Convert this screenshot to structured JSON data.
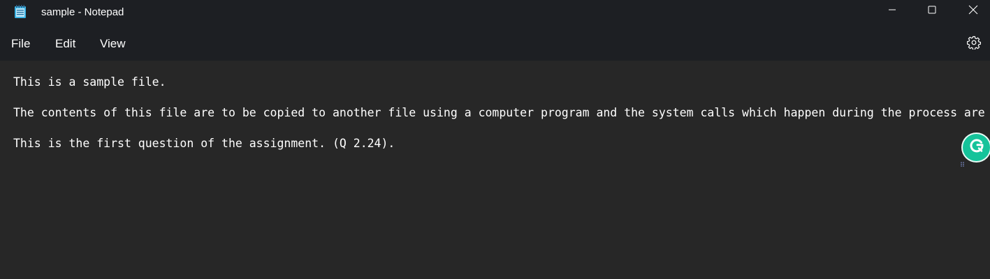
{
  "window": {
    "title": "sample - Notepad"
  },
  "titlebar": {
    "icons": {
      "app": "notepad-icon",
      "minimize": "minimize-icon",
      "maximize": "maximize-icon",
      "close": "close-icon"
    }
  },
  "menu": {
    "file": "File",
    "edit": "Edit",
    "view": "View",
    "settings_icon": "gear-icon"
  },
  "editor": {
    "lines": [
      "This is a sample file.",
      "The contents of this file are to be copied to another file using a computer program and the system calls which happen during the process are",
      "This is the first question of the assignment. (Q 2.24)."
    ]
  },
  "grammarly": {
    "icon": "grammarly-icon",
    "accent": "#15c39a"
  },
  "colors": {
    "titlebar_bg": "#1d1f23",
    "editor_bg": "#272727",
    "text": "#ffffff",
    "notepad_icon": "#3cb4e6"
  }
}
